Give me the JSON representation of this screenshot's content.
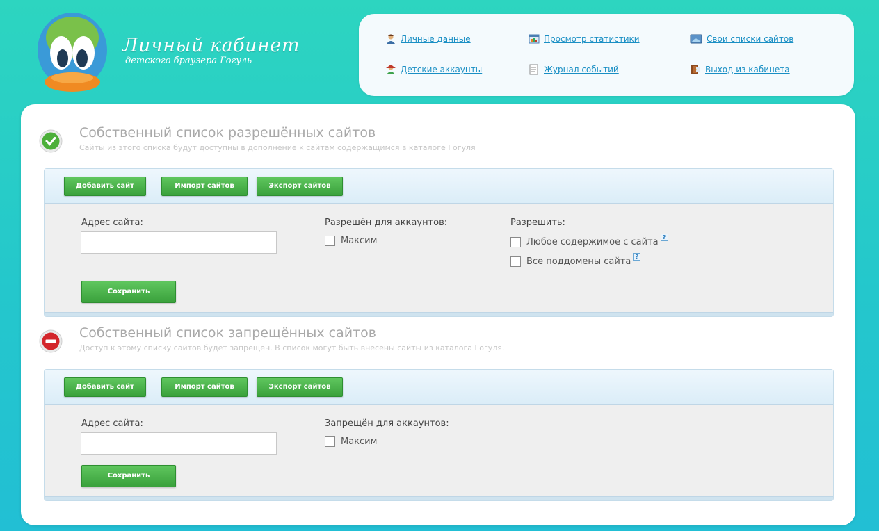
{
  "header": {
    "title": "Личный кабинет",
    "subtitle": "детского браузера Гогуль"
  },
  "nav": {
    "personal_data": "Личные данные",
    "child_accounts": "Детские аккаунты",
    "view_stats": "Просмотр статистики",
    "event_log": "Журнал событий",
    "site_lists": "Свои списки сайтов",
    "logout": "Выход из кабинета"
  },
  "allowed": {
    "title": "Собственный список разрешённых сайтов",
    "description": "Сайты из этого списка будут доступны в дополнение к сайтам содержащимся в каталоге Гогуля",
    "add_button": "Добавить сайт",
    "import_button": "Импорт сайтов",
    "export_button": "Экспорт сайтов",
    "address_label": "Адрес сайта:",
    "address_value": "",
    "accounts_label": "Разрешён для аккаунтов:",
    "account_name": "Максим",
    "allow_label": "Разрешить:",
    "option_any_content": "Любое содержимое с сайта",
    "option_subdomains": "Все поддомены сайта",
    "help_mark": "?",
    "save_button": "Сохранить"
  },
  "blocked": {
    "title": "Собственный список запрещённых сайтов",
    "description": "Доступ к этому списку сайтов будет запрещён. В список могут быть внесены сайты из каталога Гогуля.",
    "add_button": "Добавить сайт",
    "import_button": "Импорт сайтов",
    "export_button": "Экспорт сайтов",
    "address_label": "Адрес сайта:",
    "address_value": "",
    "accounts_label": "Запрещён для аккаунтов:",
    "account_name": "Максим",
    "save_button": "Сохранить"
  },
  "colors": {
    "accent_green": "#3aa13c",
    "link_blue": "#1a8fc4",
    "background_teal": "#2dd5c0"
  }
}
